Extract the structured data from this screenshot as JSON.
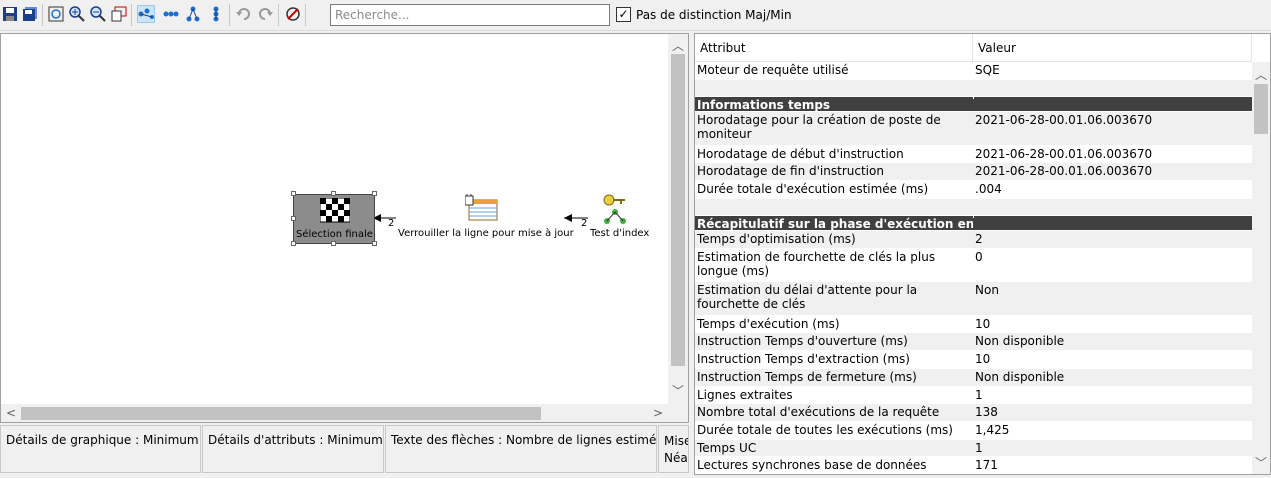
{
  "toolbar": {
    "search_placeholder": "Recherche...",
    "case_checked": "✓",
    "case_label": "Pas de distinction Maj/Min"
  },
  "graph": {
    "node_final": "Sélection finale",
    "node_lock": "Verrouiller la ligne pour mise à jour",
    "node_index": "Test d'index",
    "edge1_count": "2",
    "edge2_count": "2"
  },
  "bottom": {
    "graph_details": "Détails de graphique :  Minimum",
    "attr_details": "Détails d'attributs :  Minimum",
    "arrow_text": "Texte des flèches :  Nombre de lignes estimé",
    "cut_line1": "Mise",
    "cut_line2": "Néan"
  },
  "props": {
    "col_attr": "Attribut",
    "col_value": "Valeur",
    "rows": [
      {
        "a": "Moteur de requête utilisé",
        "v": "SQE",
        "t": "normal",
        "h": 18
      },
      {
        "a": "",
        "v": "",
        "t": "alt",
        "h": 17
      },
      {
        "a": "Informations temps",
        "v": "",
        "t": "section",
        "h": 15
      },
      {
        "a": "Horodatage pour la création de poste de moniteur",
        "v": "2021-06-28-00.01.06.003670",
        "t": "alt",
        "h": 34
      },
      {
        "a": "Horodatage de début d'instruction",
        "v": "2021-06-28-00.01.06.003670",
        "t": "normal",
        "h": 17
      },
      {
        "a": "Horodatage de fin d'instruction",
        "v": "2021-06-28-00.01.06.003670",
        "t": "alt",
        "h": 18
      },
      {
        "a": "Durée totale d'exécution estimée (ms)",
        "v": ".004",
        "t": "normal",
        "h": 18
      },
      {
        "a": "",
        "v": "",
        "t": "alt",
        "h": 17
      },
      {
        "a": "Récapitulatif sur la phase d'exécution en c",
        "v": "",
        "t": "section",
        "h": 15
      },
      {
        "a": "Temps d'optimisation (ms)",
        "v": "2",
        "t": "alt",
        "h": 18
      },
      {
        "a": "Estimation de fourchette de clés la plus longue (ms)",
        "v": "0",
        "t": "normal",
        "h": 33
      },
      {
        "a": "Estimation du délai d'attente pour la fourchette de clés",
        "v": "Non",
        "t": "alt",
        "h": 34
      },
      {
        "a": "Temps d'exécution (ms)",
        "v": "10",
        "t": "normal",
        "h": 17
      },
      {
        "a": "Instruction Temps d'ouverture (ms)",
        "v": "Non disponible",
        "t": "alt",
        "h": 18
      },
      {
        "a": "Instruction Temps d'extraction (ms)",
        "v": "10",
        "t": "normal",
        "h": 18
      },
      {
        "a": "Instruction Temps de fermeture (ms)",
        "v": "Non disponible",
        "t": "alt",
        "h": 18
      },
      {
        "a": "Lignes extraites",
        "v": "1",
        "t": "normal",
        "h": 17
      },
      {
        "a": "Nombre total d'exécutions de la requête",
        "v": "138",
        "t": "alt",
        "h": 18
      },
      {
        "a": "Durée totale de toutes les exécutions (ms)",
        "v": "1,425",
        "t": "normal",
        "h": 18
      },
      {
        "a": "Temps UC",
        "v": "1",
        "t": "alt",
        "h": 17
      },
      {
        "a": "Lectures synchrones base de données",
        "v": "171",
        "t": "normal",
        "h": 17
      }
    ]
  }
}
